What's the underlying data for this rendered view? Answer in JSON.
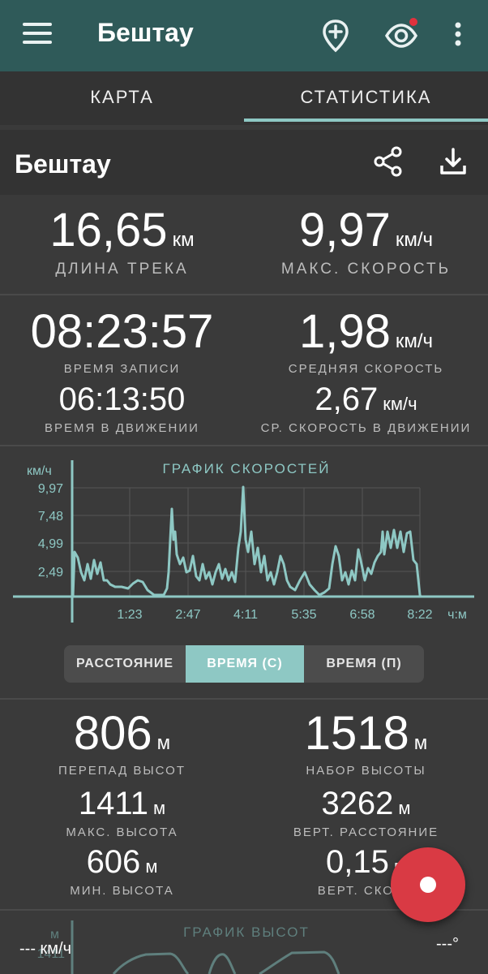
{
  "appbar": {
    "title": "Бештау"
  },
  "tabs": [
    {
      "label": "КАРТА",
      "active": false
    },
    {
      "label": "СТАТИСТИКА",
      "active": true
    }
  ],
  "track": {
    "name": "Бештау"
  },
  "stats": {
    "distance": {
      "value": "16,65",
      "unit": "км",
      "label": "ДЛИНА ТРЕКА"
    },
    "max_speed": {
      "value": "9,97",
      "unit": "км/ч",
      "label": "МАКС. СКОРОСТЬ"
    },
    "record_time": {
      "value": "08:23:57",
      "label": "ВРЕМЯ ЗАПИСИ"
    },
    "avg_speed": {
      "value": "1,98",
      "unit": "км/ч",
      "label": "СРЕДНЯЯ СКОРОСТЬ"
    },
    "moving_time": {
      "value": "06:13:50",
      "label": "ВРЕМЯ В ДВИЖЕНИИ"
    },
    "moving_avg_speed": {
      "value": "2,67",
      "unit": "км/ч",
      "label": "СР. СКОРОСТЬ В ДВИЖЕНИИ"
    }
  },
  "speed_chart": {
    "title": "ГРАФИК СКОРОСТЕЙ",
    "y_unit": "км/ч",
    "y_ticks": [
      "9,97",
      "7,48",
      "4,99",
      "2,49"
    ],
    "x_ticks": [
      "1:23",
      "2:47",
      "4:11",
      "5:35",
      "6:58",
      "8:22"
    ],
    "x_unit": "ч:м",
    "line_color": "#8ec8c4"
  },
  "segmented": {
    "options": [
      "РАССТОЯНИЕ",
      "ВРЕМЯ (С)",
      "ВРЕМЯ (П)"
    ],
    "selected": "ВРЕМЯ (С)"
  },
  "elevation": {
    "drop": {
      "value": "806",
      "unit": "м",
      "label": "ПЕРЕПАД ВЫСОТ"
    },
    "gain": {
      "value": "1518",
      "unit": "м",
      "label": "НАБОР ВЫСОТЫ"
    },
    "max": {
      "value": "1411",
      "unit": "м",
      "label": "МАКС. ВЫСОТА"
    },
    "vert_dist": {
      "value": "3262",
      "unit": "м",
      "label": "ВЕРТ. РАССТОЯНИЕ"
    },
    "min": {
      "value": "606",
      "unit": "м",
      "label": "МИН. ВЫСОТА"
    },
    "vert_speed": {
      "value": "0,15",
      "unit": "м",
      "label": "ВЕРТ. СКОРО"
    }
  },
  "elevation_chart": {
    "title": "ГРАФИК ВЫСОТ",
    "y_unit": "м",
    "first_tick": "1411"
  },
  "footer": {
    "speed": "--- км/ч",
    "angle": "---°"
  },
  "colors": {
    "appbar": "#2f5a59",
    "accent": "#8ec8c4",
    "fab": "#d93a44"
  }
}
